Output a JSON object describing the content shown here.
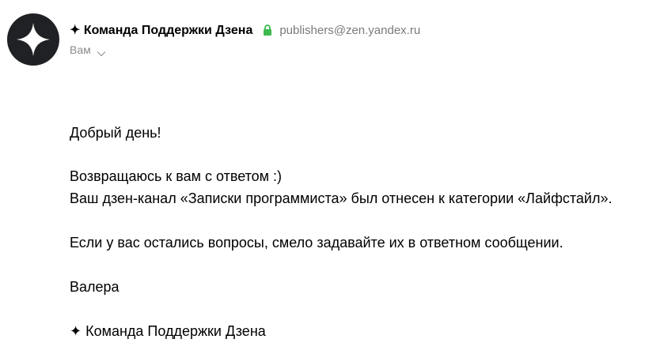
{
  "sender": {
    "name": "✦ Команда Поддержки Дзена",
    "email": "publishers@zen.yandex.ru",
    "avatar_icon": "zen-star-logo",
    "lock_icon": "lock-icon",
    "lock_color": "#3dba4e"
  },
  "recipient": {
    "label": "Вам",
    "icon": "chevron-down-icon"
  },
  "message": {
    "greeting": "Добрый день!",
    "line1": "Возвращаюсь к вам с ответом :)",
    "line2": "Ваш дзен-канал «Записки программиста» был отнесен к категории «Лайфстайл».",
    "line3": "Если у вас остались вопросы, смело задавайте их в ответном сообщении.",
    "signature_name": "Валера",
    "signature_team": "✦ Команда Поддержки Дзена"
  }
}
